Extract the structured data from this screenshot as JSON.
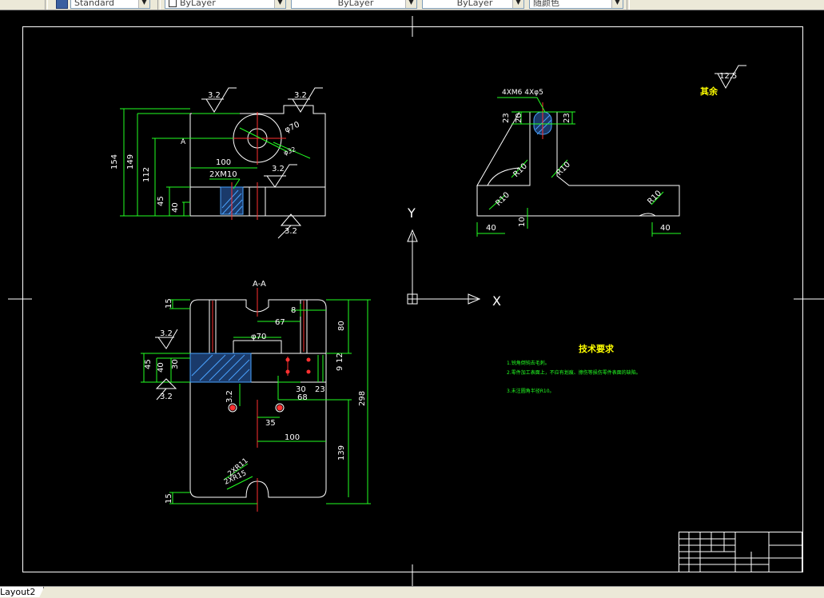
{
  "toolbar": {
    "textstyle_value": "Standard",
    "layer_value": "ByLayer",
    "linetype_value": "ByLayer",
    "lineweight_value": "ByLayer",
    "color_value": "随颜色"
  },
  "status": {
    "layout_tab": "Layout2"
  },
  "drawing": {
    "roughness": [
      "3.2",
      "3.2",
      "3.2",
      "3.2",
      "3.2",
      "3.2",
      "3.2"
    ],
    "overall_roughness": {
      "label": "其余",
      "value": "12.5"
    },
    "front_view": {
      "section_mark": "A",
      "dims": [
        "154",
        "149",
        "112",
        "45",
        "40",
        "100",
        "2XM10",
        "φ70",
        "φ32"
      ]
    },
    "side_view": {
      "thread_label": "4XM6 4Xφ5",
      "dims": [
        "23",
        "20",
        "23",
        "R10",
        "R10",
        "R10",
        "R10",
        "10",
        "40",
        "40"
      ]
    },
    "section_view": {
      "title": "A-A",
      "dims": [
        "15",
        "8",
        "67",
        "80",
        "φ70",
        "45",
        "40",
        "30",
        "12",
        "9",
        "30",
        "23",
        "68",
        "35",
        "100",
        "139",
        "298",
        "2XR11",
        "2XR15",
        "15"
      ]
    },
    "ucs": {
      "y_label": "Y",
      "x_label": "X"
    },
    "tech_req": {
      "title": "技术要求",
      "items": [
        "1.锐角倒钝去毛刺。",
        "2.零件加工表面上，不应有划痕、擦伤等损伤零件表面的缺陷。",
        "3.未注圆角半径R10。"
      ]
    }
  }
}
